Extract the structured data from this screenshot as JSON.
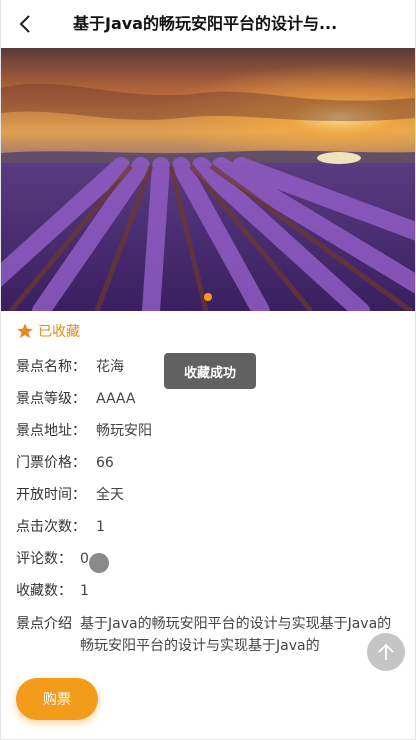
{
  "header": {
    "title": "基于Java的畅玩安阳平台的设计与..."
  },
  "collect": {
    "label": "已收藏",
    "color": "#e68a1e"
  },
  "toast": {
    "text": "收藏成功"
  },
  "info": [
    {
      "label": "景点名称：",
      "value": "花海"
    },
    {
      "label": "景点等级：",
      "value": "AAAA"
    },
    {
      "label": "景点地址：",
      "value": "畅玩安阳"
    },
    {
      "label": "门票价格：",
      "value": "66"
    },
    {
      "label": "开放时间：",
      "value": "全天"
    },
    {
      "label": "点击次数：",
      "value": "1"
    },
    {
      "label": "评论数：",
      "value": "0"
    },
    {
      "label": "收藏数：",
      "value": "1"
    }
  ],
  "intro": {
    "label": "景点介绍",
    "value": "基于Java的畅玩安阳平台的设计与实现基于Java的畅玩安阳平台的设计与实现基于Java的"
  },
  "buy_button": {
    "label": "购票",
    "color": "#f39c1b"
  },
  "icons": {
    "back": "chevron-left-icon",
    "collect": "star-icon",
    "to_top": "arrow-up-icon"
  }
}
